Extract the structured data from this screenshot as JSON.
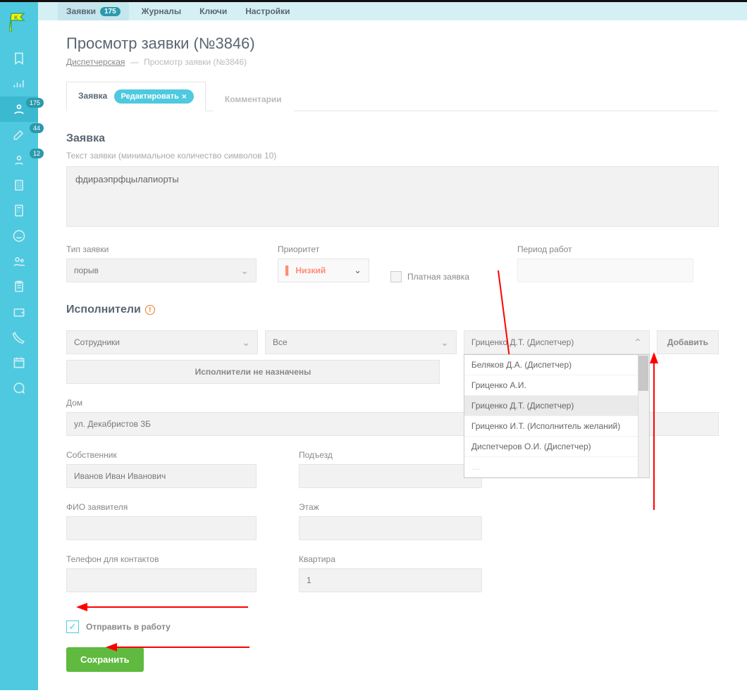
{
  "nav": {
    "requests": "Заявки",
    "requests_badge": "175",
    "journals": "Журналы",
    "keys": "Ключи",
    "settings": "Настройки"
  },
  "side_badges": {
    "b1": "175",
    "b2": "44",
    "b3": "12"
  },
  "page": {
    "title": "Просмотр заявки (№3846)",
    "crumb1": "Диспетчерская",
    "crumb2": "Просмотр заявки (№3846)"
  },
  "tabs": {
    "request": "Заявка",
    "edit": "Редактировать",
    "comments": "Комментарии"
  },
  "form": {
    "section": "Заявка",
    "hint": "Текст заявки (минимальное количество символов 10)",
    "text": "фдираэпрфцылапиорты",
    "type_label": "Тип заявки",
    "type_value": "порыв",
    "priority_label": "Приоритет",
    "priority_value": "Низкий",
    "paid_label": "Платная заявка",
    "period_label": "Период работ"
  },
  "exec": {
    "title": "Исполнители",
    "sel1": "Сотрудники",
    "sel2": "Все",
    "sel3": "Гриценко Д.Т. (Диспетчер)",
    "add": "Добавить",
    "none": "Исполнители не назначены",
    "dd": [
      "Беляков Д.А. (Диспетчер)",
      "Гриценко А.И.",
      "Гриценко Д.Т. (Диспетчер)",
      "Гриценко И.Т. (Исполнитель желаний)",
      "Диспетчеров О.И. (Диспетчер)"
    ]
  },
  "addr": {
    "house_label": "Дом",
    "house_value": "ул. Декабристов 3Б",
    "owner_label": "Собственник",
    "owner_value": "Иванов Иван Иванович",
    "fio_label": "ФИО заявителя",
    "phone_label": "Телефон для контактов",
    "entrance_label": "Подъезд",
    "floor_label": "Этаж",
    "flat_label": "Квартира",
    "flat_value": "1"
  },
  "footer": {
    "send_label": "Отправить в работу",
    "save": "Сохранить"
  }
}
